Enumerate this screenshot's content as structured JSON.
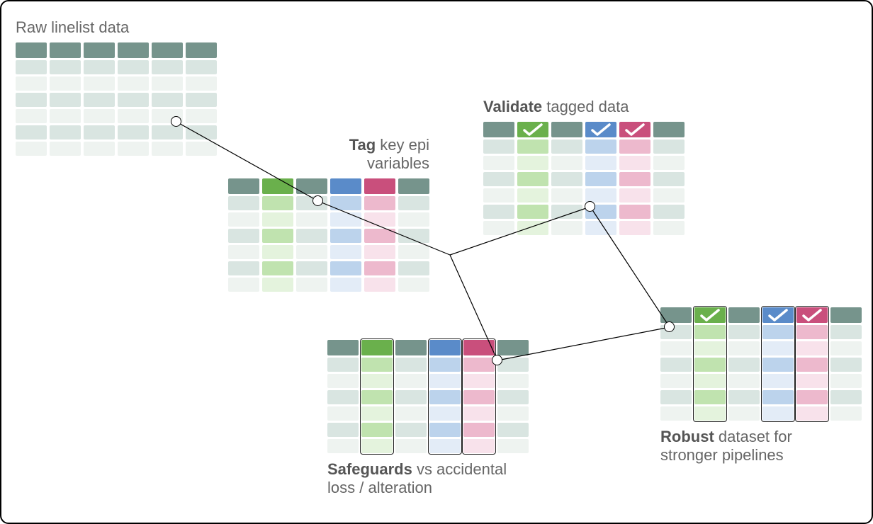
{
  "diagram": {
    "type": "process-flow",
    "description": "Data linelist pipeline: raw → tag → validate/safeguard → robust dataset",
    "stages": [
      {
        "id": "raw",
        "title_bold": "",
        "title_rest": "Raw linelist data",
        "position": "top-left",
        "columns": 6,
        "colors": [
          "muted",
          "muted",
          "muted",
          "muted",
          "muted",
          "muted"
        ],
        "checkmarks": [
          false,
          false,
          false,
          false,
          false,
          false
        ],
        "outlined": [
          false,
          false,
          false,
          false,
          false,
          false
        ]
      },
      {
        "id": "tag",
        "title_bold": "Tag",
        "title_rest": " key epi variables",
        "position": "center-left",
        "columns": 6,
        "colors": [
          "muted",
          "green",
          "muted",
          "blue",
          "pink",
          "muted"
        ],
        "checkmarks": [
          false,
          false,
          false,
          false,
          false,
          false
        ],
        "outlined": [
          false,
          false,
          false,
          false,
          false,
          false
        ]
      },
      {
        "id": "validate",
        "title_bold": "Validate",
        "title_rest": " tagged data",
        "position": "center-right",
        "columns": 6,
        "colors": [
          "muted",
          "green",
          "muted",
          "blue",
          "pink",
          "muted"
        ],
        "checkmarks": [
          false,
          true,
          false,
          true,
          true,
          false
        ],
        "outlined": [
          false,
          false,
          false,
          false,
          false,
          false
        ]
      },
      {
        "id": "safeguard",
        "title_bold": "Safeguards",
        "title_rest": " vs accidental loss / alteration",
        "position": "bottom-center",
        "columns": 6,
        "colors": [
          "muted",
          "green",
          "muted",
          "blue",
          "pink",
          "muted"
        ],
        "checkmarks": [
          false,
          false,
          false,
          false,
          false,
          false
        ],
        "outlined": [
          false,
          true,
          false,
          true,
          true,
          false
        ]
      },
      {
        "id": "robust",
        "title_bold": "Robust",
        "title_rest": " dataset for stronger pipelines",
        "position": "bottom-right",
        "columns": 6,
        "colors": [
          "muted",
          "green",
          "muted",
          "blue",
          "pink",
          "muted"
        ],
        "checkmarks": [
          false,
          true,
          false,
          true,
          true,
          false
        ],
        "outlined": [
          false,
          true,
          false,
          true,
          true,
          false
        ]
      }
    ],
    "connections": [
      [
        "raw",
        "tag"
      ],
      [
        "tag",
        "validate"
      ],
      [
        "tag",
        "safeguard"
      ],
      [
        "validate",
        "robust"
      ],
      [
        "safeguard",
        "robust"
      ]
    ],
    "palette": {
      "muted_dark": "#76948c",
      "muted_light": "#d9e5e1",
      "muted_faint": "#eef3f0",
      "green_dark": "#6ab04c",
      "green_light": "#c0e3af",
      "green_faint": "#e4f3dd",
      "blue_dark": "#5a8bc9",
      "blue_light": "#bcd3ec",
      "blue_faint": "#e3ecf7",
      "pink_dark": "#c94f7c",
      "pink_light": "#edb9cd",
      "pink_faint": "#f8e2eb",
      "text": "#666666",
      "border": "#000000"
    }
  },
  "labels": {
    "raw": "Raw linelist data",
    "tag_bold": "Tag",
    "tag_rest": " key epi",
    "tag_rest2": "variables",
    "validate_bold": "Validate",
    "validate_rest": " tagged data",
    "safeguard_bold": "Safeguards",
    "safeguard_rest": " vs accidental",
    "safeguard_rest2": "loss / alteration",
    "robust_bold": "Robust",
    "robust_rest": " dataset for",
    "robust_rest2": "stronger pipelines"
  }
}
